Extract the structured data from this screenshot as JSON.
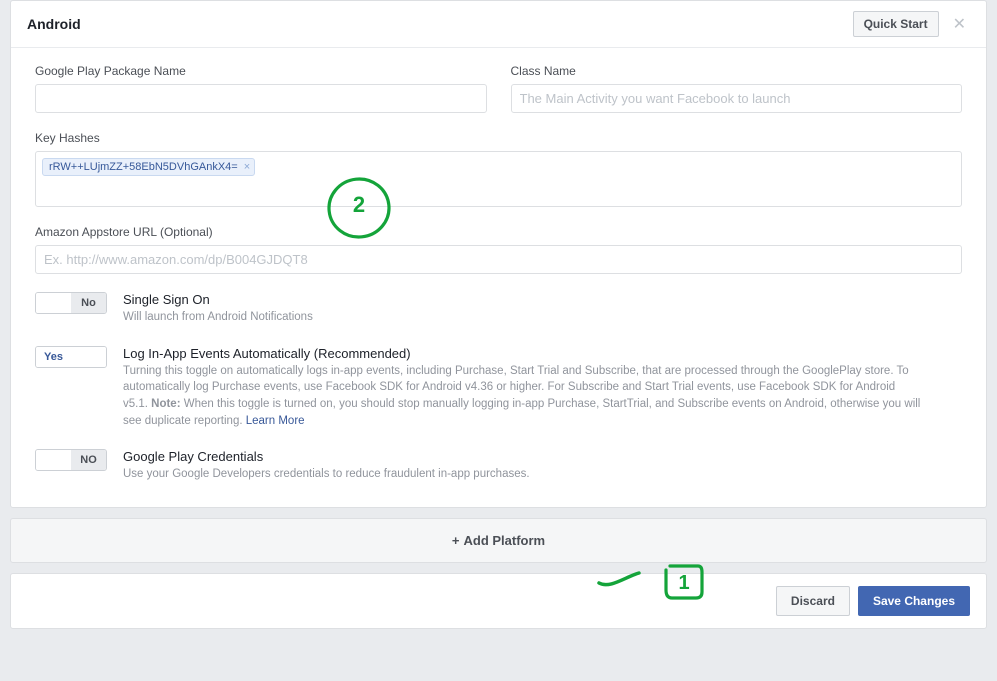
{
  "header": {
    "title": "Android",
    "quick_start": "Quick Start"
  },
  "fields": {
    "package_name_label": "Google Play Package Name",
    "class_name_label": "Class Name",
    "class_name_placeholder": "The Main Activity you want Facebook to launch",
    "key_hashes_label": "Key Hashes",
    "key_hash_tag": "rRW++LUjmZZ+58EbN5DVhGAnkX4=",
    "amazon_label": "Amazon Appstore URL (Optional)",
    "amazon_placeholder": "Ex. http://www.amazon.com/dp/B004GJDQT8"
  },
  "toggles": {
    "sso": {
      "value": "No",
      "title": "Single Sign On",
      "desc": "Will launch from Android Notifications"
    },
    "log_events": {
      "value": "Yes",
      "title": "Log In-App Events Automatically (Recommended)",
      "desc_pre": "Turning this toggle on automatically logs in-app events, including Purchase, Start Trial and Subscribe, that are processed through the GooglePlay store. To automatically log Purchase events, use Facebook SDK for Android v4.36 or higher. For Subscribe and Start Trial events, use Facebook SDK for Android v5.1. ",
      "note_label": "Note:",
      "desc_post": " When this toggle is turned on, you should stop manually logging in-app Purchase, StartTrial, and Subscribe events on Android, otherwise you will see duplicate reporting. ",
      "learn_more": "Learn More"
    },
    "play_creds": {
      "value": "NO",
      "title": "Google Play Credentials",
      "desc": "Use your Google Developers credentials to reduce fraudulent in-app purchases."
    }
  },
  "add_platform": "Add Platform",
  "footer": {
    "discard": "Discard",
    "save": "Save Changes"
  },
  "annotations": {
    "label_2": "2",
    "label_1": "1"
  }
}
